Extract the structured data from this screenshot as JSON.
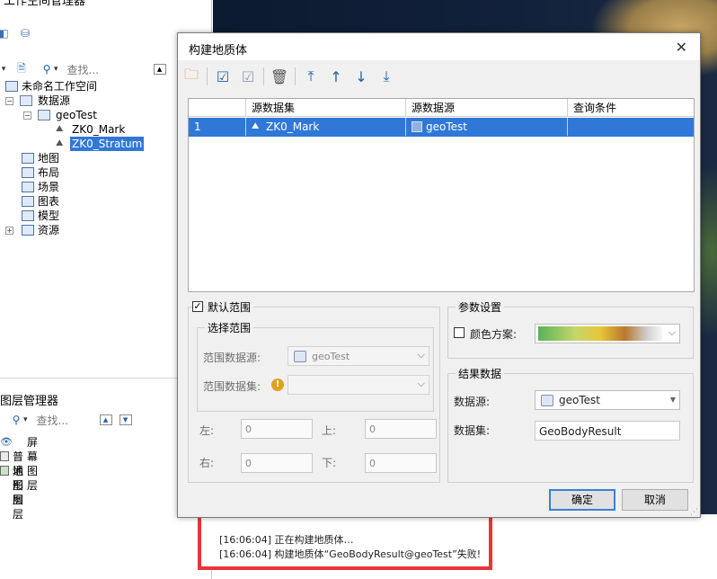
{
  "workspace_panel": {
    "title": "工作空间管理器",
    "search_placeholder": "查找...",
    "tree": [
      {
        "label": "未命名工作空间"
      },
      {
        "label": "数据源"
      },
      {
        "label": "geoTest"
      },
      {
        "label": "ZK0_Mark"
      },
      {
        "label": "ZK0_Stratum",
        "selected": true
      },
      {
        "label": "地图"
      },
      {
        "label": "布局"
      },
      {
        "label": "场景"
      },
      {
        "label": "图表"
      },
      {
        "label": "模型"
      },
      {
        "label": "资源"
      }
    ]
  },
  "layer_panel": {
    "title": "图层管理器",
    "search_placeholder": "查找...",
    "layers": [
      {
        "label": "屏幕图层"
      },
      {
        "label": "普通图层"
      },
      {
        "label": "地形图层"
      }
    ]
  },
  "dialog": {
    "title": "构建地质体",
    "close_glyph": "✕",
    "grid": {
      "columns": [
        "",
        "源数据集",
        "源数据源",
        "查询条件"
      ],
      "rows": [
        {
          "index": "1",
          "dataset": "ZK0_Mark",
          "datasource": "geoTest",
          "condition": ""
        }
      ]
    },
    "range": {
      "default_range_label": "默认范围",
      "default_range_checked": true,
      "select_range_label": "选择范围",
      "range_datasource_label": "范围数据源:",
      "range_datasource_value": "geoTest",
      "range_dataset_label": "范围数据集:",
      "left_label": "左:",
      "left_value": "0",
      "top_label": "上:",
      "top_value": "0",
      "right_label": "右:",
      "right_value": "0",
      "bottom_label": "下:",
      "bottom_value": "0"
    },
    "params": {
      "title": "参数设置",
      "color_scheme_label": "颜色方案:",
      "color_scheme_checked": false
    },
    "result": {
      "title": "结果数据",
      "datasource_label": "数据源:",
      "datasource_value": "geoTest",
      "dataset_label": "数据集:",
      "dataset_value": "GeoBodyResult"
    },
    "ok_label": "确定",
    "cancel_label": "取消"
  },
  "log": {
    "lines": [
      "[16:06:04] 正在构建地质体…",
      "[16:06:04] 构建地质体“GeoBodyResult@geoTest”失败!"
    ]
  },
  "colors": {
    "selection": "#3078d8",
    "highlight_box": "#e8353a",
    "primary_button_border": "#3c7fd5"
  }
}
